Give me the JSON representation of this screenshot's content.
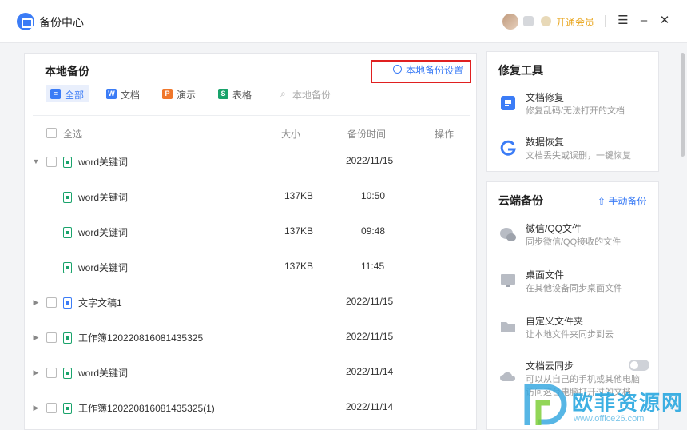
{
  "titlebar": {
    "app_title": "备份中心",
    "vip_label": "开通会员"
  },
  "local_backup": {
    "title": "本地备份",
    "settings_label": "本地备份设置",
    "filters": [
      {
        "label": "全部",
        "icon": "list-icon",
        "color": "#3b7cf6",
        "active": true
      },
      {
        "label": "文档",
        "icon": "word-icon",
        "color": "#3b7cf6"
      },
      {
        "label": "演示",
        "icon": "ppt-icon",
        "color": "#f0772b"
      },
      {
        "label": "表格",
        "icon": "excel-icon",
        "color": "#19a36b"
      },
      {
        "label": "本地备份",
        "icon": "search-icon",
        "disabled": true
      }
    ],
    "columns": {
      "select_all": "全选",
      "size": "大小",
      "time": "备份时间",
      "action": "操作"
    },
    "rows": [
      {
        "name": "word关键词",
        "size": "",
        "time": "2022/11/15",
        "expanded": true,
        "level": 0
      },
      {
        "name": "word关键词",
        "size": "137KB",
        "time": "10:50",
        "level": 1
      },
      {
        "name": "word关键词",
        "size": "137KB",
        "time": "09:48",
        "level": 1
      },
      {
        "name": "word关键词",
        "size": "137KB",
        "time": "11:45",
        "level": 1
      },
      {
        "name": "文字文稿1",
        "size": "",
        "time": "2022/11/15",
        "level": 0
      },
      {
        "name": "工作簿1202208160814353​25",
        "size": "",
        "time": "2022/11/15",
        "level": 0
      },
      {
        "name": "word关键词",
        "size": "",
        "time": "2022/11/14",
        "level": 0
      },
      {
        "name": "工作簿120220816081435325(1)",
        "size": "",
        "time": "2022/11/14",
        "level": 0
      }
    ]
  },
  "repair_tools": {
    "title": "修复工具",
    "items": [
      {
        "title": "文档修复",
        "desc": "修复乱码/无法打开的文档",
        "icon": "doc-repair-icon"
      },
      {
        "title": "数据恢复",
        "desc": "文档丢失或误删，一键恢复",
        "icon": "data-recovery-icon"
      }
    ]
  },
  "cloud_backup": {
    "title": "云端备份",
    "manual_label": "手动备份",
    "items": [
      {
        "title": "微信/QQ文件",
        "desc": "同步微信/QQ接收的文件",
        "icon": "wechat-qq-icon"
      },
      {
        "title": "桌面文件",
        "desc": "在其他设备同步桌面文件",
        "icon": "desktop-icon"
      },
      {
        "title": "自定义文件夹",
        "desc": "让本地文件夹同步到云",
        "icon": "folder-icon"
      },
      {
        "title": "文档云同步",
        "desc": "可以从自己的手机或其他电脑",
        "desc2": "访问这台电脑打开过的文档",
        "icon": "cloud-sync-icon"
      }
    ]
  },
  "watermark": {
    "text": "欧菲资源网",
    "url": "www.office26.com"
  }
}
